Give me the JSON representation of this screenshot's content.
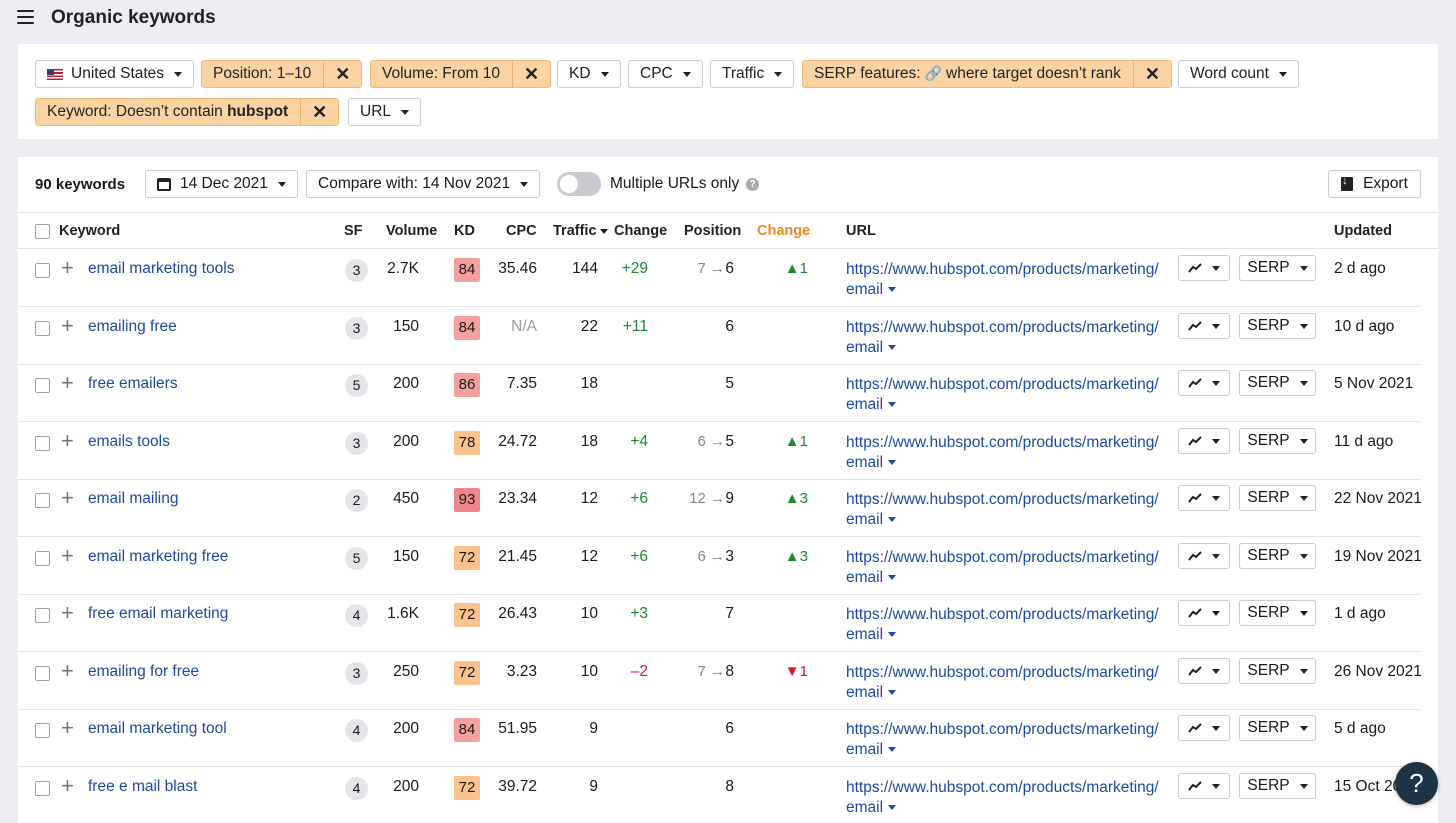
{
  "header": {
    "title": "Organic keywords"
  },
  "filters": {
    "country": "United States",
    "position": "Position: 1–10",
    "volume": "Volume: From 10",
    "kd": "KD",
    "cpc": "CPC",
    "traffic": "Traffic",
    "serp_prefix": "SERP features:",
    "serp_suffix": "where target doesn’t rank",
    "word_count": "Word count",
    "keyword_prefix": "Keyword: Doesn’t contain",
    "keyword_value": "hubspot",
    "url": "URL"
  },
  "toolbar": {
    "count": "90 keywords",
    "date": "14 Dec 2021",
    "compare": "Compare with: 14 Nov 2021",
    "multiple_urls": "Multiple URLs only",
    "help": "?",
    "export": "Export"
  },
  "columns": {
    "keyword": "Keyword",
    "sf": "SF",
    "volume": "Volume",
    "kd": "KD",
    "cpc": "CPC",
    "traffic": "Traffic",
    "change": "Change",
    "position": "Position",
    "position_change": "Change",
    "url": "URL",
    "updated": "Updated"
  },
  "colors": {
    "kd_red": "#f4a0a0",
    "kd_deep_red": "#f0868d",
    "kd_orange": "#fbc28e",
    "positive": "#1a8a2e",
    "negative": "#d6182b",
    "link": "#1d4aa3",
    "accent_orange": "#f28a1c"
  },
  "rows": [
    {
      "keyword": "email marketing tools",
      "sf": "3",
      "volume": "2.7K",
      "kd": "84",
      "kd_color": "#f4a0a0",
      "cpc": "35.46",
      "traffic": "144",
      "change": "+29",
      "change_sign": "pos",
      "pos_from": "7",
      "arrow": "→",
      "pos_to": "6",
      "pos_change_dir": "▲",
      "pos_change": "1",
      "pos_change_sign": "up",
      "url_text": "https://www.hubspot.com/products/marketing/email",
      "serp": "SERP",
      "updated": "2 d ago"
    },
    {
      "keyword": "emailing free",
      "sf": "3",
      "volume": "150",
      "kd": "84",
      "kd_color": "#f4a0a0",
      "cpc": "N/A",
      "traffic": "22",
      "change": "+11",
      "change_sign": "pos",
      "pos_from": "",
      "arrow": "",
      "pos_to": "6",
      "pos_change_dir": "",
      "pos_change": "",
      "pos_change_sign": "",
      "url_text": "https://www.hubspot.com/products/marketing/email",
      "serp": "SERP",
      "updated": "10 d ago"
    },
    {
      "keyword": "free emailers",
      "sf": "5",
      "volume": "200",
      "kd": "86",
      "kd_color": "#f4a0a0",
      "cpc": "7.35",
      "traffic": "18",
      "change": "",
      "change_sign": "",
      "pos_from": "",
      "arrow": "",
      "pos_to": "5",
      "pos_change_dir": "",
      "pos_change": "",
      "pos_change_sign": "",
      "url_text": "https://www.hubspot.com/products/marketing/email",
      "serp": "SERP",
      "updated": "5 Nov 2021"
    },
    {
      "keyword": "emails tools",
      "sf": "3",
      "volume": "200",
      "kd": "78",
      "kd_color": "#fbc28e",
      "cpc": "24.72",
      "traffic": "18",
      "change": "+4",
      "change_sign": "pos",
      "pos_from": "6",
      "arrow": "→",
      "pos_to": "5",
      "pos_change_dir": "▲",
      "pos_change": "1",
      "pos_change_sign": "up",
      "url_text": "https://www.hubspot.com/products/marketing/email",
      "serp": "SERP",
      "updated": "11 d ago"
    },
    {
      "keyword": "email mailing",
      "sf": "2",
      "volume": "450",
      "kd": "93",
      "kd_color": "#f0868d",
      "cpc": "23.34",
      "traffic": "12",
      "change": "+6",
      "change_sign": "pos",
      "pos_from": "12",
      "arrow": "→",
      "pos_to": "9",
      "pos_change_dir": "▲",
      "pos_change": "3",
      "pos_change_sign": "up",
      "url_text": "https://www.hubspot.com/products/marketing/email",
      "serp": "SERP",
      "updated": "22 Nov 2021"
    },
    {
      "keyword": "email marketing free",
      "sf": "5",
      "volume": "150",
      "kd": "72",
      "kd_color": "#fbc28e",
      "cpc": "21.45",
      "traffic": "12",
      "change": "+6",
      "change_sign": "pos",
      "pos_from": "6",
      "arrow": "→",
      "pos_to": "3",
      "pos_change_dir": "▲",
      "pos_change": "3",
      "pos_change_sign": "up",
      "url_text": "https://www.hubspot.com/products/marketing/email",
      "serp": "SERP",
      "updated": "19 Nov 2021"
    },
    {
      "keyword": "free email marketing",
      "sf": "4",
      "volume": "1.6K",
      "kd": "72",
      "kd_color": "#fbc28e",
      "cpc": "26.43",
      "traffic": "10",
      "change": "+3",
      "change_sign": "pos",
      "pos_from": "",
      "arrow": "",
      "pos_to": "7",
      "pos_change_dir": "",
      "pos_change": "",
      "pos_change_sign": "",
      "url_text": "https://www.hubspot.com/products/marketing/email",
      "serp": "SERP",
      "updated": "1 d ago"
    },
    {
      "keyword": "emailing for free",
      "sf": "3",
      "volume": "250",
      "kd": "72",
      "kd_color": "#fbc28e",
      "cpc": "3.23",
      "traffic": "10",
      "change": "–2",
      "change_sign": "neg",
      "pos_from": "7",
      "arrow": "→",
      "pos_to": "8",
      "pos_change_dir": "▼",
      "pos_change": "1",
      "pos_change_sign": "down",
      "url_text": "https://www.hubspot.com/products/marketing/email",
      "serp": "SERP",
      "updated": "26 Nov 2021"
    },
    {
      "keyword": "email marketing tool",
      "sf": "4",
      "volume": "200",
      "kd": "84",
      "kd_color": "#f4a0a0",
      "cpc": "51.95",
      "traffic": "9",
      "change": "",
      "change_sign": "",
      "pos_from": "",
      "arrow": "",
      "pos_to": "6",
      "pos_change_dir": "",
      "pos_change": "",
      "pos_change_sign": "",
      "url_text": "https://www.hubspot.com/products/marketing/email",
      "serp": "SERP",
      "updated": "5 d ago"
    },
    {
      "keyword": "free e mail blast",
      "sf": "4",
      "volume": "200",
      "kd": "72",
      "kd_color": "#fbc28e",
      "cpc": "39.72",
      "traffic": "9",
      "change": "",
      "change_sign": "",
      "pos_from": "",
      "arrow": "",
      "pos_to": "8",
      "pos_change_dir": "",
      "pos_change": "",
      "pos_change_sign": "",
      "url_text": "https://www.hubspot.com/products/marketing/email",
      "serp": "SERP",
      "updated": "15 Oct 2021"
    }
  ],
  "help_fab": "?"
}
